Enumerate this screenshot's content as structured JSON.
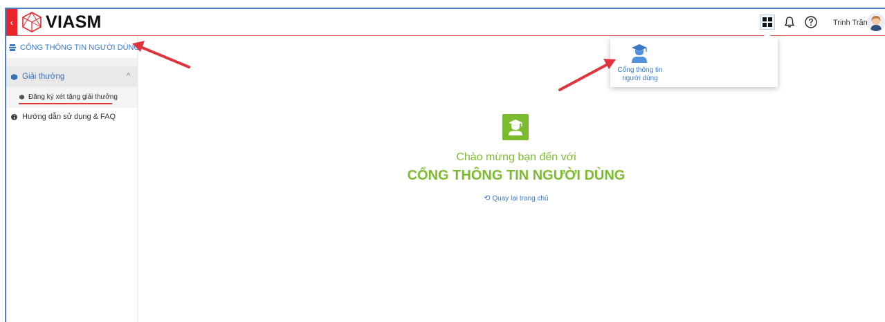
{
  "header": {
    "brand": "VIASM",
    "collapse_glyph": "‹",
    "user_name": "Trinh Trần",
    "icons": [
      "apps-grid-icon",
      "bell-icon",
      "help-icon",
      "avatar"
    ]
  },
  "sidebar": {
    "portal_title": "CỔNG THÔNG TIN NGƯỜI DÙNG",
    "group_label": "Giải thưởng",
    "group_chevron": "^",
    "sub_item_label": "Đăng ký xét tặng giải thưởng",
    "help_item_label": "Hướng dẫn sử dụng & FAQ"
  },
  "main": {
    "welcome_line": "Chào mừng bạn đến với",
    "welcome_title": "CỔNG THÔNG TIN NGƯỜI DÙNG",
    "back_link": "Quay lại trang chủ"
  },
  "dropdown": {
    "item_label_line1": "Cổng thông tin",
    "item_label_line2": "người dùng"
  },
  "colors": {
    "accent_blue": "#3a78c5",
    "accent_green": "#7dbb2e",
    "brand_red": "#e8242c",
    "arrow_red": "#e0343c"
  }
}
